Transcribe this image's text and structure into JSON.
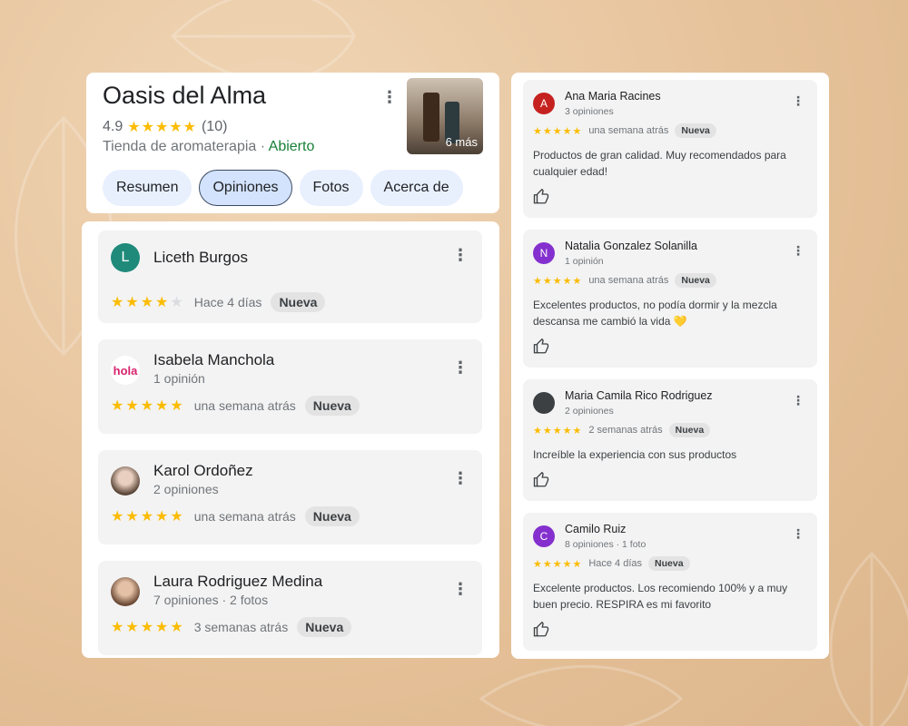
{
  "business": {
    "name": "Oasis del Alma",
    "rating": "4.9",
    "stars": "★★★★★",
    "count": "(10)",
    "category": "Tienda de aromaterapia",
    "separator": " · ",
    "status": "Abierto",
    "photos_more": "6 más",
    "tabs": [
      "Resumen",
      "Opiniones",
      "Fotos",
      "Acerca de"
    ],
    "active_tab": "Opiniones"
  },
  "left_reviews": [
    {
      "name": "Liceth Burgos",
      "subtitle": "",
      "avatar_text": "L",
      "avatar_color": "#1f8a7a",
      "stars": "★★★★",
      "empty_stars": "★",
      "when": "Hace 4 días",
      "badge": "Nueva"
    },
    {
      "name": "Isabela Manchola",
      "subtitle": "1 opinión",
      "avatar_text": "hola",
      "avatar_color": "#ffffff",
      "stars": "★★★★★",
      "empty_stars": "",
      "when": "una semana atrás",
      "badge": "Nueva"
    },
    {
      "name": "Karol Ordoñez",
      "subtitle": "2 opiniones",
      "avatar_text": "",
      "avatar_color": "#b79a85",
      "stars": "★★★★★",
      "empty_stars": "",
      "when": "una semana atrás",
      "badge": "Nueva"
    },
    {
      "name": "Laura Rodriguez Medina",
      "subtitle": "7 opiniones · 2 fotos",
      "avatar_text": "",
      "avatar_color": "#8d6a55",
      "stars": "★★★★★",
      "empty_stars": "",
      "when": "3 semanas atrás",
      "badge": "Nueva"
    }
  ],
  "right_reviews": [
    {
      "name": "Ana Maria Racines",
      "subtitle": "3 opiniones",
      "avatar_text": "A",
      "avatar_color": "#c5221f",
      "stars": "★★★★★",
      "when": "una semana atrás",
      "badge": "Nueva",
      "text": "Productos de gran calidad. Muy recomendados para cualquier edad!"
    },
    {
      "name": "Natalia Gonzalez Solanilla",
      "subtitle": "1 opinión",
      "avatar_text": "N",
      "avatar_color": "#8430ce",
      "stars": "★★★★★",
      "when": "una semana atrás",
      "badge": "Nueva",
      "text": "Excelentes productos, no podía dormir y la mezcla descansa me cambió la vida 💛"
    },
    {
      "name": "Maria Camila Rico Rodriguez",
      "subtitle": "2 opiniones",
      "avatar_text": "",
      "avatar_color": "#3c4043",
      "stars": "★★★★★",
      "when": "2 semanas atrás",
      "badge": "Nueva",
      "text": "Increíble la experiencia con sus productos"
    },
    {
      "name": "Camilo Ruiz",
      "subtitle": "8 opiniones · 1 foto",
      "avatar_text": "C",
      "avatar_color": "#8430ce",
      "stars": "★★★★★",
      "when": "Hace 4 días",
      "badge": "Nueva",
      "text": "Excelente productos. Los recomiendo 100% y a muy buen precio. RESPIRA es mi favorito"
    }
  ],
  "colors": {
    "star": "#fbbc04",
    "open": "#188038",
    "background": "#e6c29a"
  },
  "icons": {
    "more": "more-vert-icon",
    "like": "thumbs-up-icon"
  }
}
